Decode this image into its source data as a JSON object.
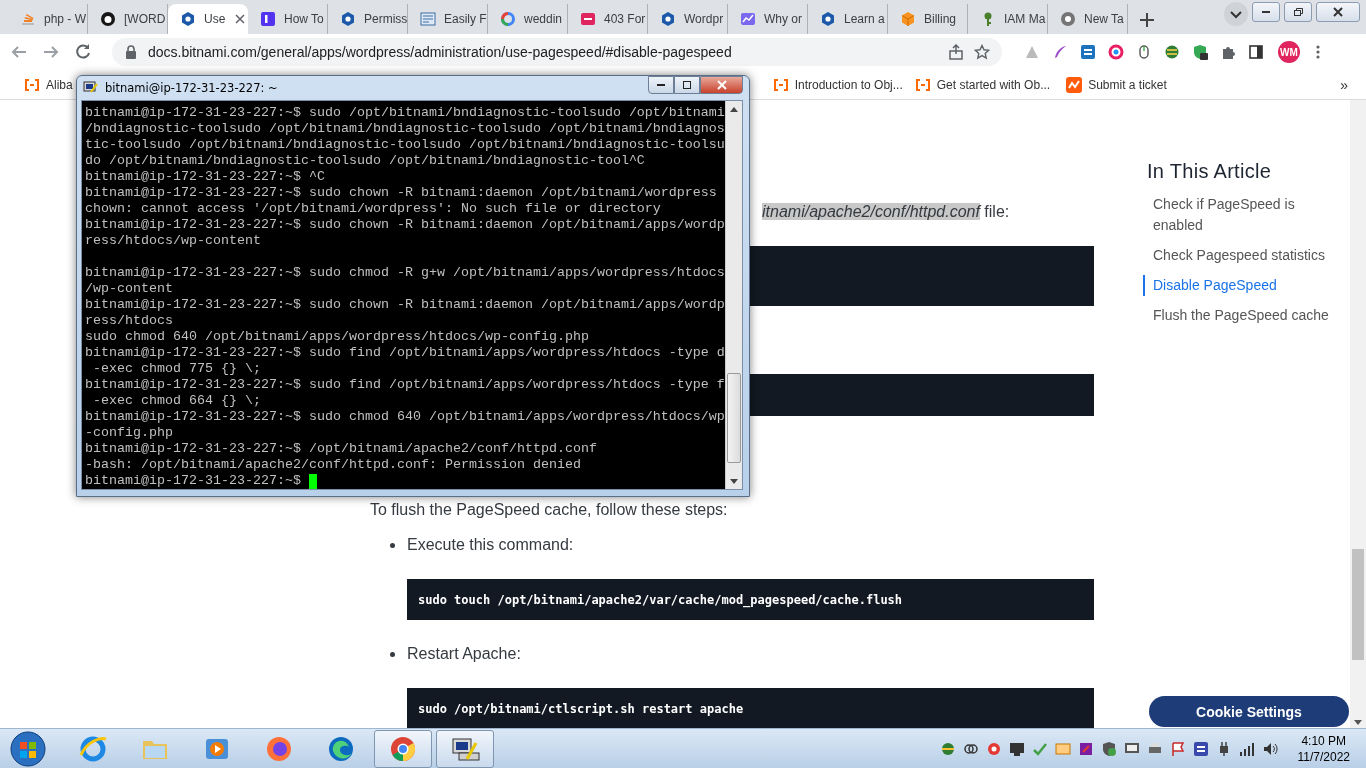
{
  "browser": {
    "tabs": [
      {
        "title": "php - W",
        "kind": "bars",
        "selected": false
      },
      {
        "title": "[WORD",
        "kind": "round",
        "selected": false
      },
      {
        "title": "Use",
        "kind": "hexagon",
        "selected": true
      },
      {
        "title": "How To",
        "kind": "square",
        "selected": false
      },
      {
        "title": "Permiss",
        "kind": "hexagon",
        "selected": false
      },
      {
        "title": "Easily F",
        "kind": "document",
        "selected": false
      },
      {
        "title": "weddin",
        "kind": "ring",
        "selected": false
      },
      {
        "title": "403 For",
        "kind": "redsquare",
        "selected": false
      },
      {
        "title": "Wordpr",
        "kind": "hexagon",
        "selected": false
      },
      {
        "title": "Why or",
        "kind": "chart",
        "selected": false
      },
      {
        "title": "Learn a",
        "kind": "hexagon",
        "selected": false
      },
      {
        "title": "Billing",
        "kind": "cube",
        "selected": false
      },
      {
        "title": "IAM Ma",
        "kind": "key",
        "selected": false
      },
      {
        "title": "New Ta",
        "kind": "circle",
        "selected": false
      }
    ],
    "address": "docs.bitnami.com/general/apps/wordpress/administration/use-pagespeed/#disable-pagespeed",
    "profile": "WM",
    "bookmarks": [
      {
        "label": "Aliba",
        "kind": "bracket"
      },
      {
        "label": "Introduction to Obj...",
        "kind": "bracket"
      },
      {
        "label": "Get started with Ob...",
        "kind": "bracket"
      },
      {
        "label": "Submit a ticket",
        "kind": "wave"
      }
    ],
    "bookmarks_more": "»"
  },
  "terminal": {
    "title": "bitnami@ip-172-31-23-227: ~",
    "lines": [
      {
        "text": "bitnami@ip-172-31-23-227:~$ sudo /opt/bitnami/bndiagnostic-toolsudo /opt/bitnami"
      },
      {
        "text": "/bndiagnostic-toolsudo /opt/bitnami/bndiagnostic-toolsudo /opt/bitnami/bndiagnos"
      },
      {
        "text": "tic-toolsudo /opt/bitnami/bndiagnostic-toolsudo /opt/bitnami/bndiagnostic-toolsu"
      },
      {
        "text": "do /opt/bitnami/bndiagnostic-toolsudo /opt/bitnami/bndiagnostic-tool^C"
      },
      {
        "text": "bitnami@ip-172-31-23-227:~$ ^C"
      },
      {
        "text": "bitnami@ip-172-31-23-227:~$ sudo chown -R bitnami:daemon /opt/bitnami/wordpress"
      },
      {
        "text": "chown: cannot access '/opt/bitnami/wordpress': No such file or directory"
      },
      {
        "text": "bitnami@ip-172-31-23-227:~$ sudo chown -R bitnami:daemon /opt/bitnami/apps/wordp"
      },
      {
        "text": "ress/htdocs/wp-content"
      },
      {
        "text": "bitnami@ip-172-31-23-227:~$ sudo chmod -R g+w /opt/bitnami/apps/wordpress/htdocs",
        "gap_before": true
      },
      {
        "text": "/wp-content"
      },
      {
        "text": "bitnami@ip-172-31-23-227:~$ sudo chown -R bitnami:daemon /opt/bitnami/apps/wordp"
      },
      {
        "text": "ress/htdocs"
      },
      {
        "text": "sudo chmod 640 /opt/bitnami/apps/wordpress/htdocs/wp-config.php"
      },
      {
        "text": "bitnami@ip-172-31-23-227:~$ sudo find /opt/bitnami/apps/wordpress/htdocs -type d"
      },
      {
        "text": " -exec chmod 775 {} \\;"
      },
      {
        "text": "bitnami@ip-172-31-23-227:~$ sudo find /opt/bitnami/apps/wordpress/htdocs -type f"
      },
      {
        "text": " -exec chmod 664 {} \\;"
      },
      {
        "text": "bitnami@ip-172-31-23-227:~$ sudo chmod 640 /opt/bitnami/apps/wordpress/htdocs/wp"
      },
      {
        "text": "-config.php"
      },
      {
        "text": "bitnami@ip-172-31-23-227:~$ /opt/bitnami/apache2/conf/httpd.conf"
      },
      {
        "text": "-bash: /opt/bitnami/apache2/conf/httpd.conf: Permission denied"
      },
      {
        "text": "bitnami@ip-172-31-23-227:~$",
        "cursor": true
      }
    ]
  },
  "article": {
    "blocks": [
      {
        "kind": "partial",
        "text": "*itnami/apache2/conf/httpd.conf* file:"
      },
      {
        "kind": "code"
      },
      {
        "kind": "code"
      },
      {
        "kind": "paragraph",
        "text": "To flush the PageSpeed cache, follow these steps:"
      },
      {
        "kind": "bullet",
        "text": "Execute this command:"
      },
      {
        "kind": "command",
        "text": "sudo touch /opt/bitnami/apache2/var/cache/mod_pagespeed/cache.flush"
      },
      {
        "kind": "bullet",
        "text": "Restart Apache:"
      },
      {
        "kind": "command",
        "text": "sudo /opt/bitnami/ctlscript.sh restart apache"
      }
    ]
  },
  "toc": {
    "title": "In This Article",
    "items": [
      {
        "label": "Check if PageSpeed is enabled",
        "selected": false
      },
      {
        "label": "Check Pagespeed statistics",
        "selected": false
      },
      {
        "label": "Disable PageSpeed",
        "selected": true
      },
      {
        "label": "Flush the PageSpeed cache",
        "selected": false
      }
    ]
  },
  "cookie_button": "Cookie Settings",
  "taskbar": {
    "apps": [
      {
        "kind": "ie",
        "open": false
      },
      {
        "kind": "folder",
        "open": false
      },
      {
        "kind": "media",
        "open": false
      },
      {
        "kind": "firefox",
        "open": false
      },
      {
        "kind": "edge",
        "open": false
      },
      {
        "kind": "chrome",
        "open": true
      },
      {
        "kind": "putty",
        "open": true
      }
    ],
    "time": "4:10 PM",
    "date": "11/7/2022"
  }
}
